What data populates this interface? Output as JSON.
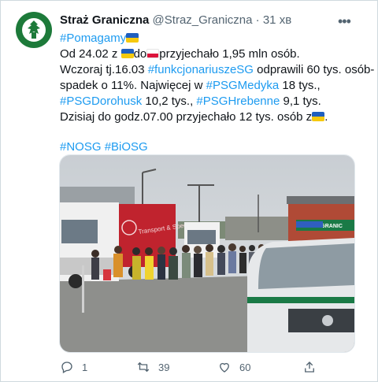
{
  "author": {
    "display_name": "Straż Graniczna",
    "handle": "@Straz_Graniczna",
    "separator": "·",
    "time": "31 хв"
  },
  "more_icon": "•••",
  "tweet": {
    "hashtag_pomagamy": "#Pomagamy",
    "l2_a": "Od 24.02 z ",
    "l2_b": "do",
    "l2_c": "przyjechało 1,95 mln osób.",
    "l3_a": "Wczoraj tj.16.03 ",
    "l3_tag": "#funkcjonariuszeSG",
    "l3_b": " odprawili 60 tys. osób-",
    "l4_a": "spadek o 11%. Najwięcej w ",
    "l4_tag": "#PSGMedyka",
    "l4_b": " 18 tys.,",
    "l5_tag1": "#PSGDorohusk",
    "l5_a": " 10,2 tys., ",
    "l5_tag2": "#PSGHrebenne",
    "l5_b": " 9,1 tys.",
    "l6_a": "Dzisiaj do godz.07.00 przyjechało 12 tys. osób z",
    "l6_b": ".",
    "tag_nosg": "#NOSG",
    "tag_biosg": "#BiOSG"
  },
  "photo": {
    "truck_text": "Transport & Spedition",
    "building_sign": "STRAŻ GRANIC"
  },
  "actions": {
    "reply_count": "1",
    "retweet_count": "39",
    "like_count": "60"
  },
  "colors": {
    "accent": "#1d9bf0",
    "ua_blue": "#1f5fbf",
    "ua_yellow": "#f6c90e",
    "pl_red": "#dc143c",
    "sg_green": "#1d7a3a"
  }
}
